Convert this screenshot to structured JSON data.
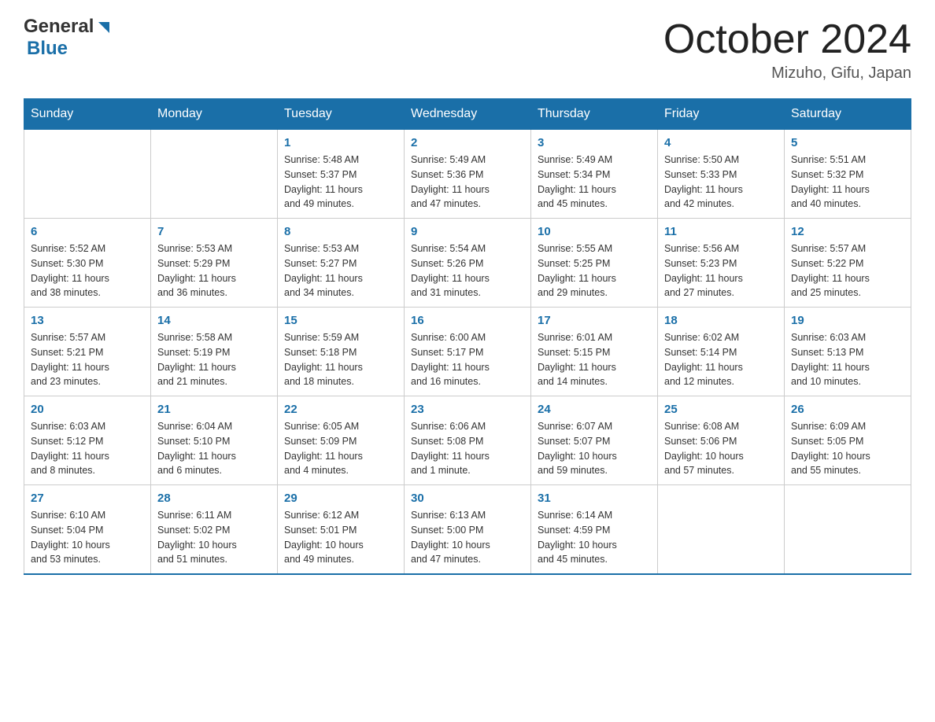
{
  "header": {
    "logo_general": "General",
    "logo_blue": "Blue",
    "title": "October 2024",
    "location": "Mizuho, Gifu, Japan"
  },
  "weekdays": [
    "Sunday",
    "Monday",
    "Tuesday",
    "Wednesday",
    "Thursday",
    "Friday",
    "Saturday"
  ],
  "weeks": [
    [
      {
        "day": "",
        "info": ""
      },
      {
        "day": "",
        "info": ""
      },
      {
        "day": "1",
        "info": "Sunrise: 5:48 AM\nSunset: 5:37 PM\nDaylight: 11 hours\nand 49 minutes."
      },
      {
        "day": "2",
        "info": "Sunrise: 5:49 AM\nSunset: 5:36 PM\nDaylight: 11 hours\nand 47 minutes."
      },
      {
        "day": "3",
        "info": "Sunrise: 5:49 AM\nSunset: 5:34 PM\nDaylight: 11 hours\nand 45 minutes."
      },
      {
        "day": "4",
        "info": "Sunrise: 5:50 AM\nSunset: 5:33 PM\nDaylight: 11 hours\nand 42 minutes."
      },
      {
        "day": "5",
        "info": "Sunrise: 5:51 AM\nSunset: 5:32 PM\nDaylight: 11 hours\nand 40 minutes."
      }
    ],
    [
      {
        "day": "6",
        "info": "Sunrise: 5:52 AM\nSunset: 5:30 PM\nDaylight: 11 hours\nand 38 minutes."
      },
      {
        "day": "7",
        "info": "Sunrise: 5:53 AM\nSunset: 5:29 PM\nDaylight: 11 hours\nand 36 minutes."
      },
      {
        "day": "8",
        "info": "Sunrise: 5:53 AM\nSunset: 5:27 PM\nDaylight: 11 hours\nand 34 minutes."
      },
      {
        "day": "9",
        "info": "Sunrise: 5:54 AM\nSunset: 5:26 PM\nDaylight: 11 hours\nand 31 minutes."
      },
      {
        "day": "10",
        "info": "Sunrise: 5:55 AM\nSunset: 5:25 PM\nDaylight: 11 hours\nand 29 minutes."
      },
      {
        "day": "11",
        "info": "Sunrise: 5:56 AM\nSunset: 5:23 PM\nDaylight: 11 hours\nand 27 minutes."
      },
      {
        "day": "12",
        "info": "Sunrise: 5:57 AM\nSunset: 5:22 PM\nDaylight: 11 hours\nand 25 minutes."
      }
    ],
    [
      {
        "day": "13",
        "info": "Sunrise: 5:57 AM\nSunset: 5:21 PM\nDaylight: 11 hours\nand 23 minutes."
      },
      {
        "day": "14",
        "info": "Sunrise: 5:58 AM\nSunset: 5:19 PM\nDaylight: 11 hours\nand 21 minutes."
      },
      {
        "day": "15",
        "info": "Sunrise: 5:59 AM\nSunset: 5:18 PM\nDaylight: 11 hours\nand 18 minutes."
      },
      {
        "day": "16",
        "info": "Sunrise: 6:00 AM\nSunset: 5:17 PM\nDaylight: 11 hours\nand 16 minutes."
      },
      {
        "day": "17",
        "info": "Sunrise: 6:01 AM\nSunset: 5:15 PM\nDaylight: 11 hours\nand 14 minutes."
      },
      {
        "day": "18",
        "info": "Sunrise: 6:02 AM\nSunset: 5:14 PM\nDaylight: 11 hours\nand 12 minutes."
      },
      {
        "day": "19",
        "info": "Sunrise: 6:03 AM\nSunset: 5:13 PM\nDaylight: 11 hours\nand 10 minutes."
      }
    ],
    [
      {
        "day": "20",
        "info": "Sunrise: 6:03 AM\nSunset: 5:12 PM\nDaylight: 11 hours\nand 8 minutes."
      },
      {
        "day": "21",
        "info": "Sunrise: 6:04 AM\nSunset: 5:10 PM\nDaylight: 11 hours\nand 6 minutes."
      },
      {
        "day": "22",
        "info": "Sunrise: 6:05 AM\nSunset: 5:09 PM\nDaylight: 11 hours\nand 4 minutes."
      },
      {
        "day": "23",
        "info": "Sunrise: 6:06 AM\nSunset: 5:08 PM\nDaylight: 11 hours\nand 1 minute."
      },
      {
        "day": "24",
        "info": "Sunrise: 6:07 AM\nSunset: 5:07 PM\nDaylight: 10 hours\nand 59 minutes."
      },
      {
        "day": "25",
        "info": "Sunrise: 6:08 AM\nSunset: 5:06 PM\nDaylight: 10 hours\nand 57 minutes."
      },
      {
        "day": "26",
        "info": "Sunrise: 6:09 AM\nSunset: 5:05 PM\nDaylight: 10 hours\nand 55 minutes."
      }
    ],
    [
      {
        "day": "27",
        "info": "Sunrise: 6:10 AM\nSunset: 5:04 PM\nDaylight: 10 hours\nand 53 minutes."
      },
      {
        "day": "28",
        "info": "Sunrise: 6:11 AM\nSunset: 5:02 PM\nDaylight: 10 hours\nand 51 minutes."
      },
      {
        "day": "29",
        "info": "Sunrise: 6:12 AM\nSunset: 5:01 PM\nDaylight: 10 hours\nand 49 minutes."
      },
      {
        "day": "30",
        "info": "Sunrise: 6:13 AM\nSunset: 5:00 PM\nDaylight: 10 hours\nand 47 minutes."
      },
      {
        "day": "31",
        "info": "Sunrise: 6:14 AM\nSunset: 4:59 PM\nDaylight: 10 hours\nand 45 minutes."
      },
      {
        "day": "",
        "info": ""
      },
      {
        "day": "",
        "info": ""
      }
    ]
  ]
}
